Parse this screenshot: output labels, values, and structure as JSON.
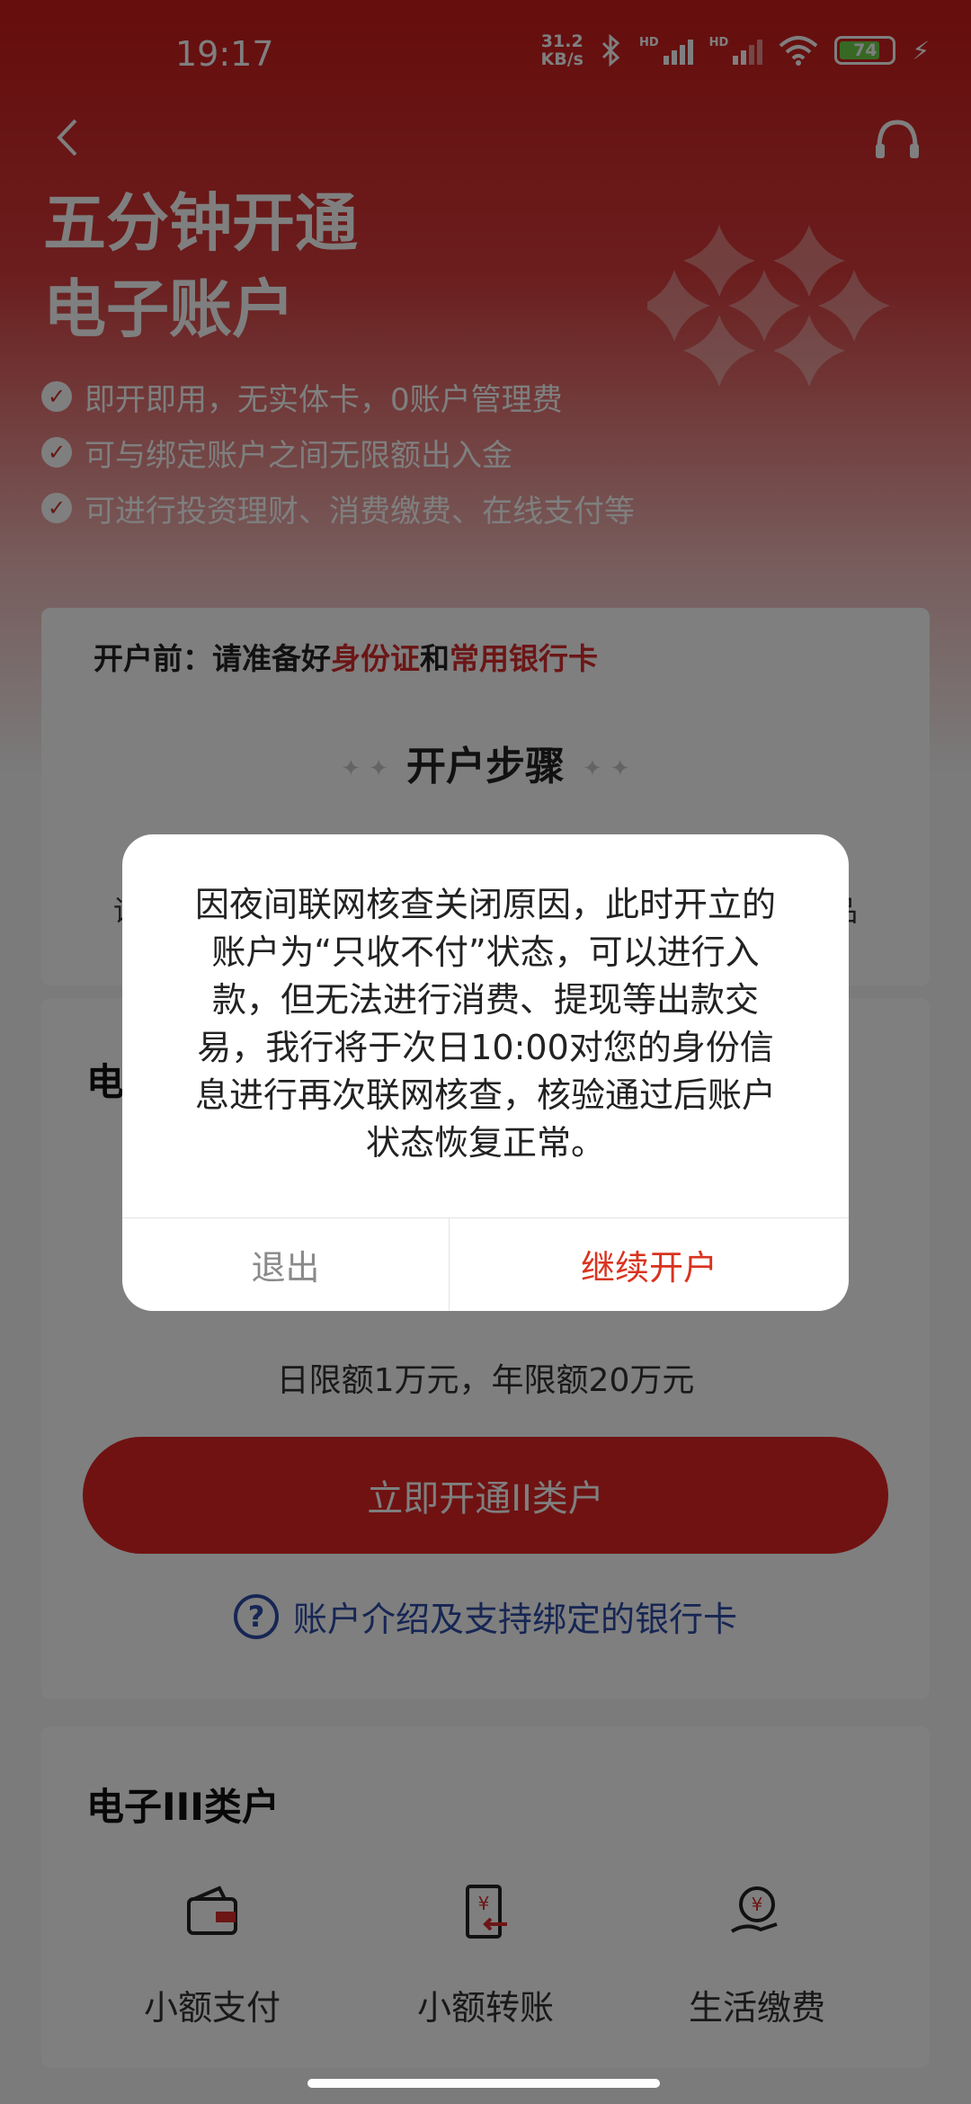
{
  "status_bar": {
    "time": "19:17",
    "net_speed_value": "31.2",
    "net_speed_unit": "KB/s",
    "hd1": "HD",
    "hd2": "HD",
    "battery": "74"
  },
  "header": {
    "title_line1": "五分钟开通",
    "title_line2": "电子账户",
    "features": [
      "即开即用，无实体卡，0账户管理费",
      "可与绑定账户之间无限额出入金",
      "可进行投资理财、消费缴费、在线支付等"
    ]
  },
  "steps_card": {
    "prep_prefix": "开户前：请准备好",
    "prep_id": "身份证",
    "prep_and": "和",
    "prep_card": "常用银行卡",
    "title": "开户步骤",
    "hint_left": "请",
    "hint_right": "品"
  },
  "account_ii": {
    "title_partial": "电",
    "limit": "日限额1万元，年限额20万元",
    "open_button": "立即开通II类户",
    "info_link": "账户介绍及支持绑定的银行卡"
  },
  "account_iii": {
    "title": "电子III类户",
    "features": [
      {
        "label": "小额支付",
        "icon": "wallet-icon"
      },
      {
        "label": "小额转账",
        "icon": "transfer-icon"
      },
      {
        "label": "生活缴费",
        "icon": "bill-icon"
      }
    ]
  },
  "dialog": {
    "message": "因夜间联网核查关闭原因，此时开立的账户为“只收不付”状态，可以进行入款，但无法进行消费、提现等出款交易，我行将于次日10:00对您的身份信息进行再次联网核查，核验通过后账户状态恢复正常。",
    "cancel": "退出",
    "confirm": "继续开户"
  },
  "colors": {
    "brand_red": "#d82c2c",
    "link_blue": "#2d4ca8",
    "confirm_red": "#d9331f"
  }
}
